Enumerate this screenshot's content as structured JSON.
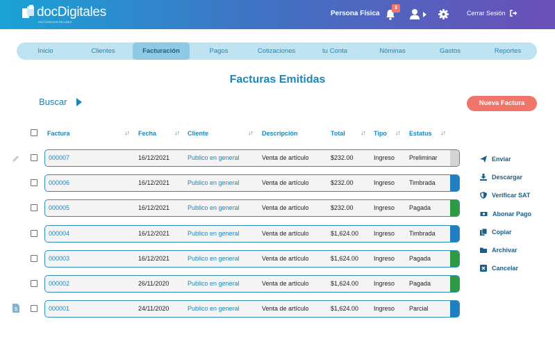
{
  "header": {
    "logo_text_a": "doc",
    "logo_text_b": "Digitales",
    "logo_sub": "FACTURACION EN LINEA",
    "persona": "Persona Física",
    "notifications_count": "3",
    "logout_label": "Cerrar Sesión",
    "gradient_colors": [
      "#1aa3d6",
      "#3f74c4",
      "#6a4fb8"
    ]
  },
  "nav": {
    "items": [
      {
        "label": "Inicio"
      },
      {
        "label": "Clientes"
      },
      {
        "label": "Facturación"
      },
      {
        "label": "Pagos"
      },
      {
        "label": "Cotizaciones"
      },
      {
        "label": "tu Conta"
      },
      {
        "label": "Nóminas"
      },
      {
        "label": "Gastos"
      },
      {
        "label": "Reportes"
      }
    ],
    "active": "Facturación"
  },
  "page": {
    "title": "Facturas Emitidas",
    "search_label": "Buscar",
    "new_invoice_label": "Nueva Factura"
  },
  "table": {
    "headers": [
      "Factura",
      "Fecha",
      "Cliente",
      "Descripción",
      "Total",
      "Tipo",
      "Estatus"
    ],
    "rows": [
      {
        "factura": "000007",
        "fecha": "16/12/2021",
        "cliente": "Publico en general",
        "descripcion": "Venta de artículo",
        "total": "$232.00",
        "tipo": "Ingreso",
        "estatus": "Preliminar",
        "status_color": "#d4d4d4"
      },
      {
        "factura": "000006",
        "fecha": "16/12/2021",
        "cliente": "Publico en general",
        "descripcion": "Venta de artículo",
        "total": "$232.00",
        "tipo": "Ingreso",
        "estatus": "Timbrada",
        "status_color": "#1f7fc0"
      },
      {
        "factura": "000005",
        "fecha": "16/12/2021",
        "cliente": "Publico en general",
        "descripcion": "Venta de artículo",
        "total": "$232.00",
        "tipo": "Ingreso",
        "estatus": "Pagada",
        "status_color": "#2e9a44"
      },
      {
        "factura": "000004",
        "fecha": "16/12/2021",
        "cliente": "Publico en general",
        "descripcion": "Venta de artículo",
        "total": "$1,624.00",
        "tipo": "Ingreso",
        "estatus": "Timbrada",
        "status_color": "#1f7fc0"
      },
      {
        "factura": "000003",
        "fecha": "16/12/2021",
        "cliente": "Publico en general",
        "descripcion": "Venta de artículo",
        "total": "$1,624.00",
        "tipo": "Ingreso",
        "estatus": "Pagada",
        "status_color": "#2e9a44"
      },
      {
        "factura": "000002",
        "fecha": "26/11/2020",
        "cliente": "Publico en general",
        "descripcion": "Venta de artículo",
        "total": "$1,624.00",
        "tipo": "Ingreso",
        "estatus": "Pagada",
        "status_color": "#2e9a44"
      },
      {
        "factura": "000001",
        "fecha": "24/11/2020",
        "cliente": "Publico en general",
        "descripcion": "Venta de artículo",
        "total": "$1,624.00",
        "tipo": "Ingreso",
        "estatus": "Parcial",
        "status_color": "#1f7fc0"
      }
    ]
  },
  "actions": [
    {
      "label": "Enviar",
      "icon": "send-icon"
    },
    {
      "label": "Descargar",
      "icon": "download-icon"
    },
    {
      "label": "Verificar SAT",
      "icon": "shield-icon"
    },
    {
      "label": "Abonar Pago",
      "icon": "money-icon"
    },
    {
      "label": "Copiar",
      "icon": "copy-icon"
    },
    {
      "label": "Archivar",
      "icon": "folder-icon"
    },
    {
      "label": "Cancelar",
      "icon": "cancel-icon"
    }
  ],
  "colors": {
    "accent": "#1a86b8",
    "button": "#f0766b",
    "nav_bg": "#bfe3f1",
    "nav_active": "#8fcae4",
    "row_border": "#2f8cbf"
  }
}
